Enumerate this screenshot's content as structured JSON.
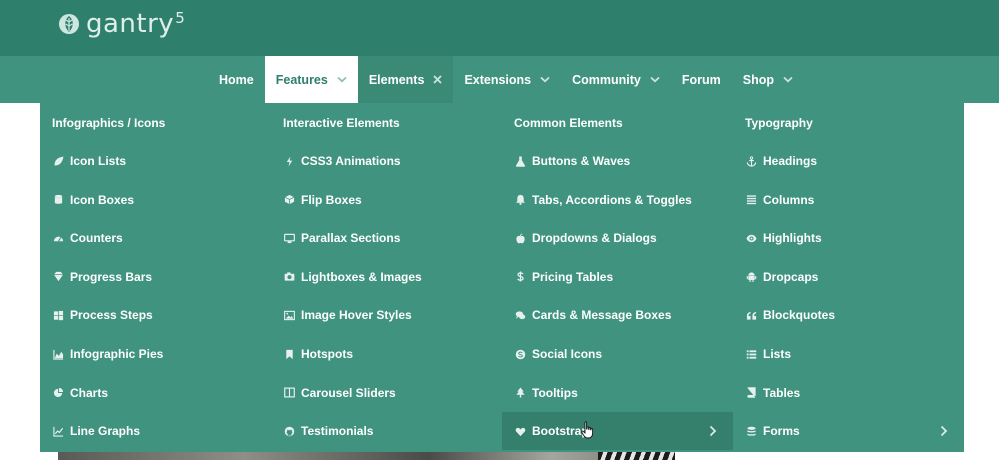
{
  "brand": {
    "name": "gantry",
    "version": "5"
  },
  "nav": [
    {
      "label": "Home",
      "chevron": false
    },
    {
      "label": "Features",
      "chevron": true,
      "state": "active"
    },
    {
      "label": "Elements",
      "close": true,
      "state": "open"
    },
    {
      "label": "Extensions",
      "chevron": true
    },
    {
      "label": "Community",
      "chevron": true
    },
    {
      "label": "Forum",
      "chevron": false
    },
    {
      "label": "Shop",
      "chevron": true
    }
  ],
  "dropdown": {
    "columns": [
      {
        "title": "Infographics / Icons",
        "items": [
          {
            "label": "Icon Lists",
            "icon": "leaf-icon"
          },
          {
            "label": "Icon Boxes",
            "icon": "database-icon"
          },
          {
            "label": "Counters",
            "icon": "dashboard-icon"
          },
          {
            "label": "Progress Bars",
            "icon": "diamond-icon"
          },
          {
            "label": "Process Steps",
            "icon": "windows-icon"
          },
          {
            "label": "Infographic Pies",
            "icon": "area-chart-icon"
          },
          {
            "label": "Charts",
            "icon": "pie-chart-icon"
          },
          {
            "label": "Line Graphs",
            "icon": "line-chart-icon"
          }
        ]
      },
      {
        "title": "Interactive Elements",
        "items": [
          {
            "label": "CSS3 Animations",
            "icon": "bolt-icon"
          },
          {
            "label": "Flip Boxes",
            "icon": "cube-icon"
          },
          {
            "label": "Parallax Sections",
            "icon": "desktop-icon"
          },
          {
            "label": "Lightboxes & Images",
            "icon": "camera-icon"
          },
          {
            "label": "Image Hover Styles",
            "icon": "image-icon"
          },
          {
            "label": "Hotspots",
            "icon": "bookmark-icon"
          },
          {
            "label": "Carousel Sliders",
            "icon": "columns-icon"
          },
          {
            "label": "Testimonials",
            "icon": "github-icon"
          }
        ]
      },
      {
        "title": "Common Elements",
        "items": [
          {
            "label": "Buttons & Waves",
            "icon": "flask-icon"
          },
          {
            "label": "Tabs, Accordions & Toggles",
            "icon": "bell-icon"
          },
          {
            "label": "Dropdowns & Dialogs",
            "icon": "apple-icon"
          },
          {
            "label": "Pricing Tables",
            "icon": "dollar-icon"
          },
          {
            "label": "Cards & Message Boxes",
            "icon": "comments-icon"
          },
          {
            "label": "Social Icons",
            "icon": "skype-icon"
          },
          {
            "label": "Tooltips",
            "icon": "tree-icon"
          },
          {
            "label": "Bootstrap",
            "icon": "heart-icon",
            "submenu": true,
            "highlighted": true
          }
        ]
      },
      {
        "title": "Typography",
        "items": [
          {
            "label": "Headings",
            "icon": "anchor-icon"
          },
          {
            "label": "Columns",
            "icon": "align-icon"
          },
          {
            "label": "Highlights",
            "icon": "eye-icon"
          },
          {
            "label": "Dropcaps",
            "icon": "android-icon"
          },
          {
            "label": "Blockquotes",
            "icon": "quote-icon"
          },
          {
            "label": "Lists",
            "icon": "list-icon"
          },
          {
            "label": "Tables",
            "icon": "book-icon"
          },
          {
            "label": "Forms",
            "icon": "stack-icon",
            "submenu": true
          }
        ]
      }
    ]
  },
  "colors": {
    "header": "#2e806d",
    "navbar": "#40937f",
    "dropdown": "#40937f",
    "highlight": "#357f6d"
  }
}
